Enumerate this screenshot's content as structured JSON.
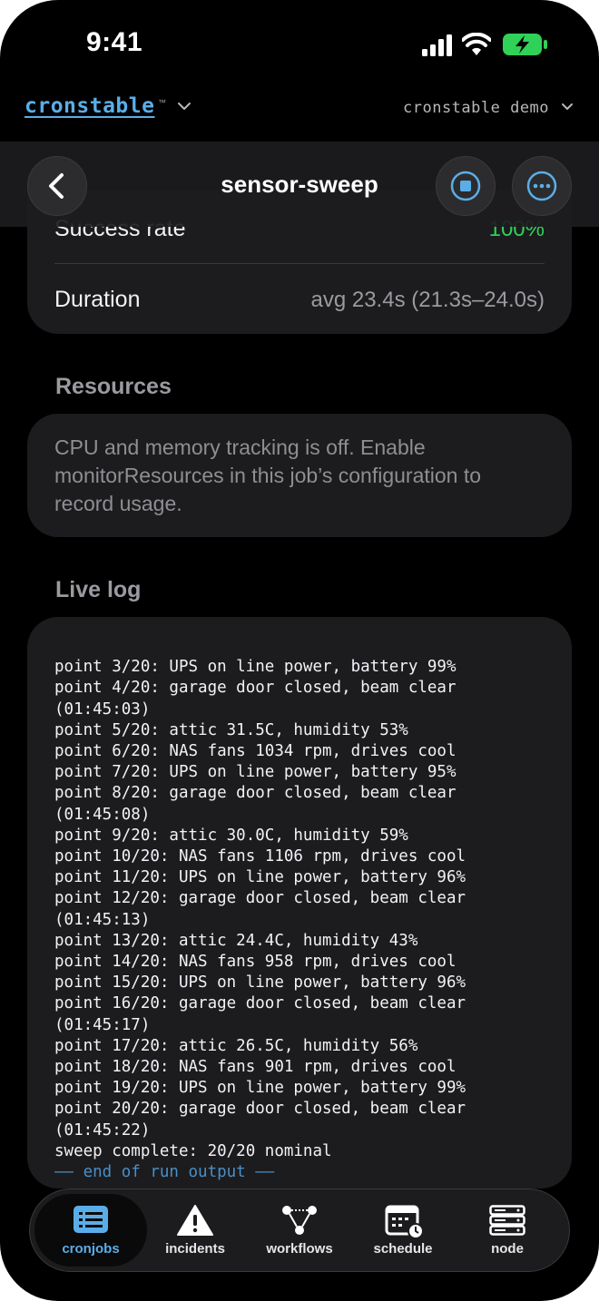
{
  "status_bar": {
    "time": "9:41"
  },
  "app_bar": {
    "brand": "cronstable",
    "trademark": "™",
    "project": "cronstable demo"
  },
  "nav": {
    "title": "sensor-sweep",
    "back_icon": "chevron-left-icon",
    "stop_icon": "stop-icon",
    "more_icon": "ellipsis-icon"
  },
  "stats": {
    "success_label": "Success rate",
    "success_value": "100%",
    "duration_label": "Duration",
    "duration_value": "avg 23.4s (21.3s–24.0s)"
  },
  "resources": {
    "title": "Resources",
    "message": "CPU and memory tracking is off. Enable monitorResources in this job’s configuration to record usage."
  },
  "live_log": {
    "title": "Live log",
    "lines": [
      "point 3/20: UPS on line power, battery 99%",
      "point 4/20: garage door closed, beam clear",
      "(01:45:03)",
      "point 5/20: attic 31.5C, humidity 53%",
      "point 6/20: NAS fans 1034 rpm, drives cool",
      "point 7/20: UPS on line power, battery 95%",
      "point 8/20: garage door closed, beam clear",
      "(01:45:08)",
      "point 9/20: attic 30.0C, humidity 59%",
      "point 10/20: NAS fans 1106 rpm, drives cool",
      "point 11/20: UPS on line power, battery 96%",
      "point 12/20: garage door closed, beam clear",
      "(01:45:13)",
      "point 13/20: attic 24.4C, humidity 43%",
      "point 14/20: NAS fans 958 rpm, drives cool",
      "point 15/20: UPS on line power, battery 96%",
      "point 16/20: garage door closed, beam clear",
      "(01:45:17)",
      "point 17/20: attic 26.5C, humidity 56%",
      "point 18/20: NAS fans 901 rpm, drives cool",
      "point 19/20: UPS on line power, battery 99%",
      "point 20/20: garage door closed, beam clear",
      "(01:45:22)",
      "sweep complete: 20/20 nominal"
    ],
    "end_marker": "—— end of run output ——"
  },
  "tabs": [
    {
      "label": "cronjobs",
      "icon": "list-icon",
      "active": true
    },
    {
      "label": "incidents",
      "icon": "warning-icon",
      "active": false
    },
    {
      "label": "workflows",
      "icon": "workflow-icon",
      "active": false
    },
    {
      "label": "schedule",
      "icon": "calendar-clock-icon",
      "active": false
    },
    {
      "label": "node",
      "icon": "server-icon",
      "active": false
    }
  ],
  "colors": {
    "accent": "#5aaee8",
    "success": "#30d158",
    "background": "#000000",
    "card": "#1c1c1e"
  }
}
